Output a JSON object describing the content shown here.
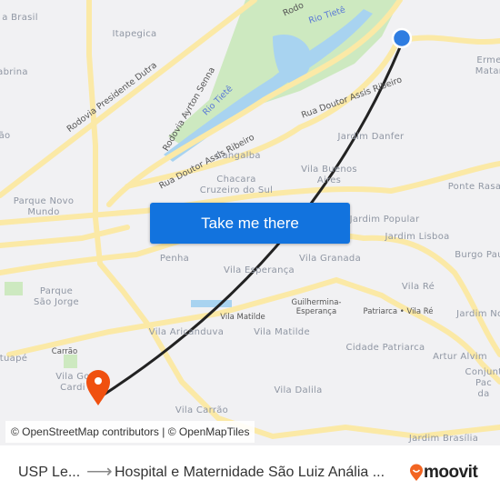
{
  "map": {
    "labels": [
      "a Brasil",
      "Itapegica",
      "abrina",
      "ão",
      "Parque Novo\nMundo",
      "Cangalba",
      "Chacara\nCruzeiro do Sul",
      "Jardim Danfer",
      "Vila Buenos\nAires",
      "Ponte Rasa",
      "Erme\nMatar",
      "Jardim Popular",
      "Jardim Lisboa",
      "Burgo Pau",
      "Penha",
      "Vila Esperança",
      "Vila Granada",
      "Parque\nSão Jorge",
      "Vila Ré",
      "Guilhermina-\nEsperança",
      "Vila Matilde",
      "Patriarca • Vila Ré",
      "Jardim Nor",
      "Vila Aricanduva",
      "Vila Matilde",
      "Cidade Patriarca",
      "Artur Alvim",
      "Carrão",
      "tuapé",
      "Vila Go\nCardi",
      "Conjunt\nPac\nda",
      "Vila Carrão",
      "Vila Dalila",
      "Jardim Brasília"
    ],
    "roads": [
      "Rodovia Presidente Dutra",
      "Rodovia Ayrton Senna",
      "Rua Doutor Assis Ribeiro",
      "Rua Doutor Assis Ribeiro",
      "Rodo"
    ],
    "rivers": [
      "Rio Tietê",
      "Rio Tietê"
    ],
    "origin_color": "#2f7de1",
    "destination_color": "#f0500f",
    "route_color": "#222222"
  },
  "cta_label": "Take me there",
  "attribution": "© OpenStreetMap contributors | © OpenMapTiles",
  "footer": {
    "from": "USP Le...",
    "to": "Hospital e Maternidade São Luiz Anália ...",
    "brand": "moovit",
    "brand_color": "#f26522"
  }
}
